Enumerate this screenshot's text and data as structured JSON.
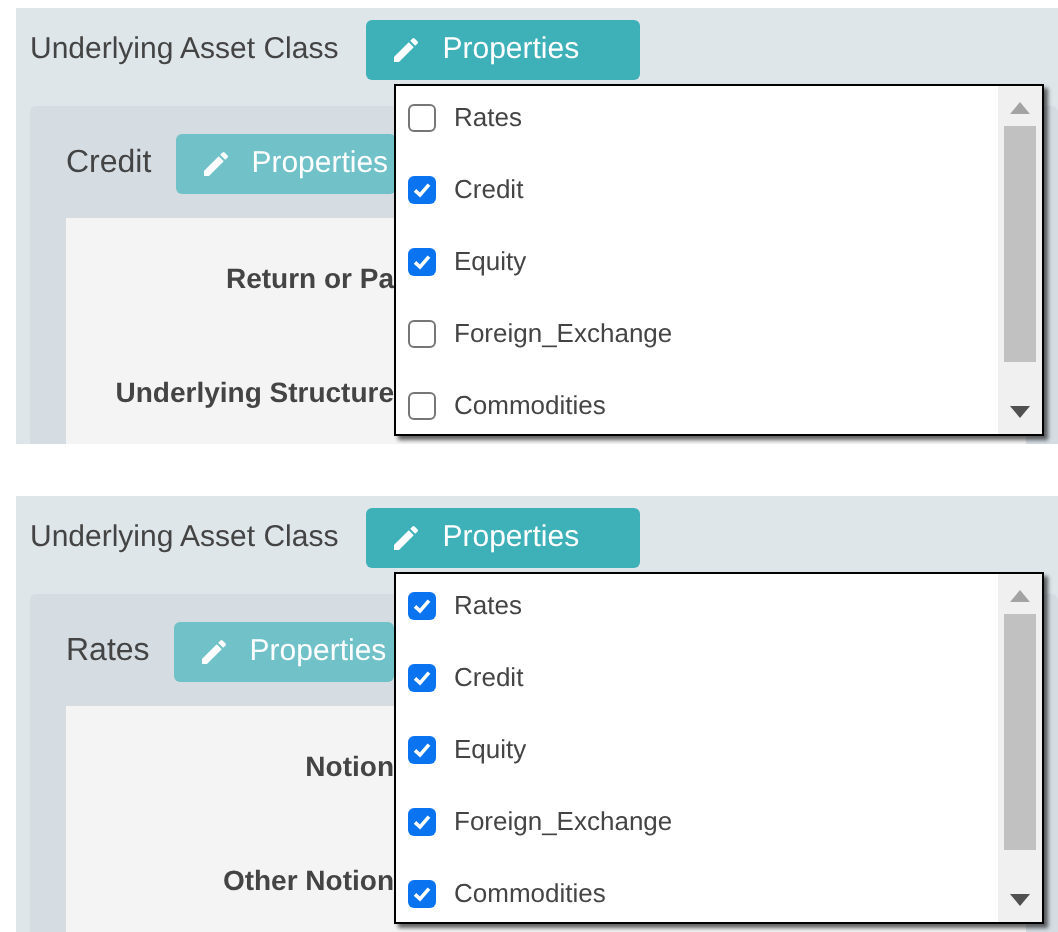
{
  "panels": [
    {
      "title": "Underlying Asset Class",
      "button": "Properties",
      "section": {
        "title": "Credit",
        "button": "Properties",
        "fields": [
          "Return or Pa",
          "Underlying Structure"
        ]
      },
      "dropdown": {
        "options": [
          {
            "label": "Rates",
            "checked": false
          },
          {
            "label": "Credit",
            "checked": true
          },
          {
            "label": "Equity",
            "checked": true
          },
          {
            "label": "Foreign_Exchange",
            "checked": false
          },
          {
            "label": "Commodities",
            "checked": false
          }
        ]
      }
    },
    {
      "title": "Underlying Asset Class",
      "button": "Properties",
      "section": {
        "title": "Rates",
        "button": "Properties",
        "fields": [
          "Notion",
          "Other Notion"
        ]
      },
      "dropdown": {
        "options": [
          {
            "label": "Rates",
            "checked": true
          },
          {
            "label": "Credit",
            "checked": true
          },
          {
            "label": "Equity",
            "checked": true
          },
          {
            "label": "Foreign_Exchange",
            "checked": true
          },
          {
            "label": "Commodities",
            "checked": true
          }
        ]
      }
    }
  ]
}
